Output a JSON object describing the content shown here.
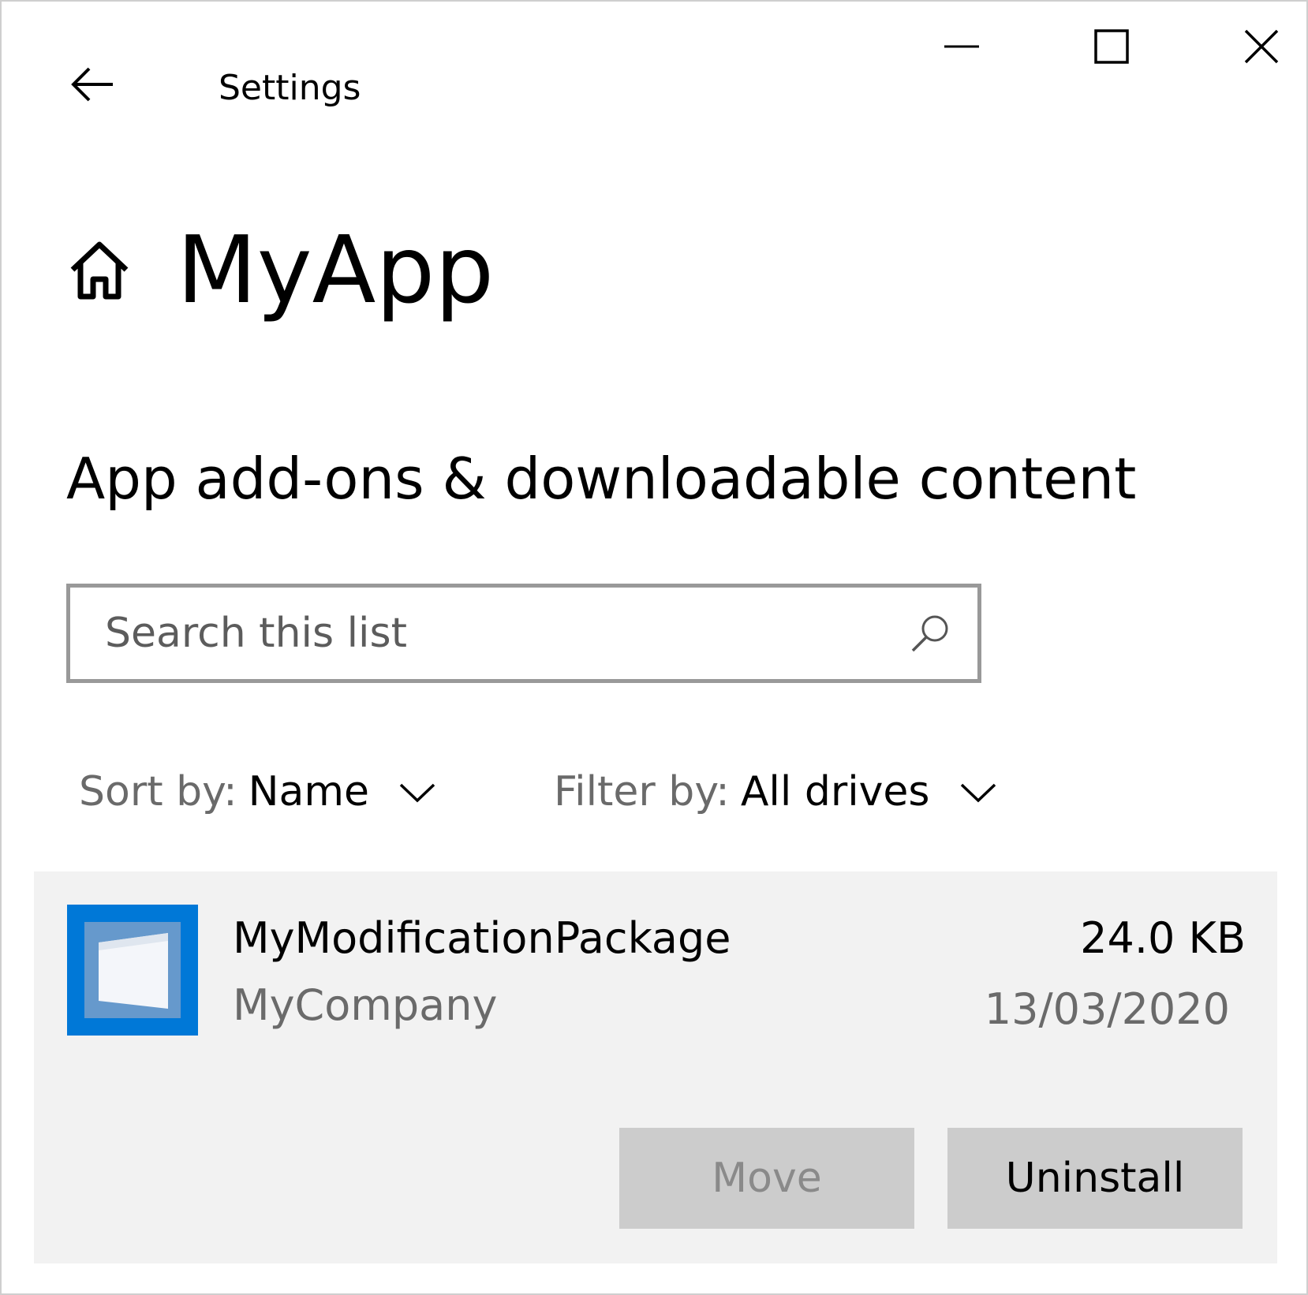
{
  "window": {
    "title": "Settings",
    "controls": {
      "minimize": "minimize-icon",
      "maximize": "maximize-icon",
      "close": "close-icon"
    }
  },
  "header": {
    "back_icon": "back-arrow-icon",
    "home_icon": "home-icon",
    "app_name": "MyApp"
  },
  "section": {
    "title": "App add-ons & downloadable content"
  },
  "search": {
    "placeholder": "Search this list",
    "value": "",
    "icon": "search-icon"
  },
  "sort": {
    "label": "Sort by:",
    "value": "Name"
  },
  "filter": {
    "label": "Filter by:",
    "value": "All drives"
  },
  "packages": [
    {
      "name": "MyModificationPackage",
      "publisher": "MyCompany",
      "size": "24.0 KB",
      "date": "13/03/2020",
      "icon": "package-icon",
      "move_label": "Move",
      "move_enabled": false,
      "uninstall_label": "Uninstall"
    }
  ],
  "colors": {
    "accent": "#0078d7",
    "item_background": "#f2f2f2",
    "button_background": "#cccccc",
    "secondary_text": "#6a6a6a"
  }
}
